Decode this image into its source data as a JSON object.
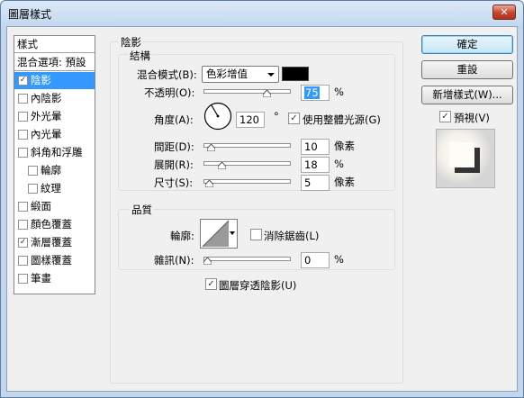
{
  "window": {
    "title": "圖層樣式",
    "close_glyph": "✕"
  },
  "styles_list": {
    "header": "樣式",
    "blend_options": "混合選項: 預設",
    "items": [
      {
        "label": "陰影",
        "checked": true,
        "selected": true,
        "indent": false
      },
      {
        "label": "內陰影",
        "checked": false,
        "selected": false,
        "indent": false
      },
      {
        "label": "外光暈",
        "checked": false,
        "selected": false,
        "indent": false
      },
      {
        "label": "內光暈",
        "checked": false,
        "selected": false,
        "indent": false
      },
      {
        "label": "斜角和浮雕",
        "checked": false,
        "selected": false,
        "indent": false
      },
      {
        "label": "輪廓",
        "checked": false,
        "selected": false,
        "indent": true
      },
      {
        "label": "紋理",
        "checked": false,
        "selected": false,
        "indent": true
      },
      {
        "label": "緞面",
        "checked": false,
        "selected": false,
        "indent": false
      },
      {
        "label": "顏色覆蓋",
        "checked": false,
        "selected": false,
        "indent": false
      },
      {
        "label": "漸層覆蓋",
        "checked": true,
        "selected": false,
        "indent": false
      },
      {
        "label": "圖樣覆蓋",
        "checked": false,
        "selected": false,
        "indent": false
      },
      {
        "label": "筆畫",
        "checked": false,
        "selected": false,
        "indent": false
      }
    ]
  },
  "shadow": {
    "section_title": "陰影",
    "structure": {
      "title": "結構",
      "blend_mode_label": "混合模式(B):",
      "blend_mode_value": "色彩增值",
      "blend_color": "#000000",
      "opacity_label": "不透明(O):",
      "opacity_value": "75",
      "opacity_unit": "%",
      "opacity_fraction": 0.75,
      "angle_label": "角度(A):",
      "angle_value": "120",
      "angle_unit": "°",
      "global_light_label": "使用整體光源(G)",
      "global_light_checked": true,
      "distance_label": "間距(D):",
      "distance_value": "10",
      "distance_unit": "像素",
      "distance_fraction": 0.04,
      "spread_label": "展開(R):",
      "spread_value": "18",
      "spread_unit": "%",
      "spread_fraction": 0.18,
      "size_label": "尺寸(S):",
      "size_value": "5",
      "size_unit": "像素",
      "size_fraction": 0.02
    },
    "quality": {
      "title": "品質",
      "contour_label": "輪廓:",
      "anti_alias_label": "消除鋸齒(L)",
      "anti_alias_checked": false,
      "noise_label": "雜訊(N):",
      "noise_value": "0",
      "noise_unit": "%",
      "noise_fraction": 0.0
    },
    "knockout_label": "圖層穿透陰影(U)",
    "knockout_checked": true
  },
  "buttons": {
    "ok": "確定",
    "reset": "重設",
    "new_style": "新增樣式(W)...",
    "preview_label": "預視(V)",
    "preview_checked": true
  },
  "colors": {
    "selection": "#3399ff",
    "title_bar": "#c4d8ee",
    "close": "#c4432c"
  },
  "check_glyph": "✓"
}
